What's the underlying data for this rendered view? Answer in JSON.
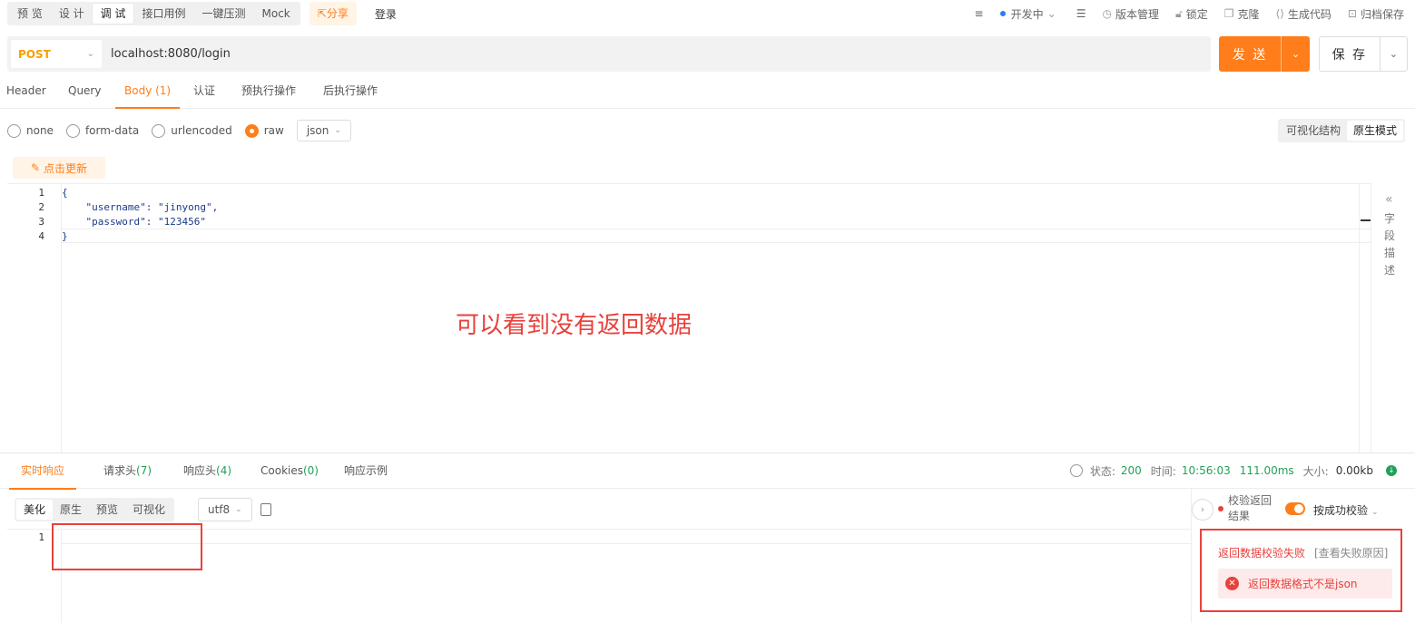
{
  "topbar": {
    "tabs": [
      {
        "label": "预 览"
      },
      {
        "label": "设 计"
      },
      {
        "label": "调 试",
        "active": true
      },
      {
        "label": "接口用例"
      },
      {
        "label": "一键压测"
      },
      {
        "label": "Mock"
      }
    ],
    "share_label": "分享",
    "login_label": "登录",
    "status_label": "开发中",
    "version_label": "版本管理",
    "lock_label": "锁定",
    "clone_label": "克隆",
    "codegen_label": "生成代码",
    "archive_label": "归档保存"
  },
  "request": {
    "method": "POST",
    "url": "localhost:8080/login",
    "send_label": "发 送",
    "save_label": "保 存"
  },
  "req_tabs": [
    {
      "label": "Header"
    },
    {
      "label": "Query"
    },
    {
      "label": "Body (1)",
      "active": true
    },
    {
      "label": "认证"
    },
    {
      "label": "预执行操作"
    },
    {
      "label": "后执行操作"
    }
  ],
  "body_types": {
    "none": "none",
    "form_data": "form-data",
    "urlencoded": "urlencoded",
    "raw": "raw",
    "selected": "raw",
    "format": "json"
  },
  "modes": {
    "visual": "可视化结构",
    "raw": "原生模式"
  },
  "refresh_label": "点击更新",
  "editor": {
    "lines": [
      "1",
      "2",
      "3",
      "4"
    ],
    "code": [
      "{",
      "    \"username\": \"jinyong\",",
      "    \"password\": \"123456\"",
      "}"
    ]
  },
  "side_panel_label": "字段描述",
  "annotation": "可以看到没有返回数据",
  "response": {
    "tabs": {
      "live": "实时响应",
      "req_headers": "请求头",
      "req_headers_count": "(7)",
      "resp_headers": "响应头",
      "resp_headers_count": "(4)",
      "cookies": "Cookies",
      "cookies_count": "(0)",
      "example": "响应示例"
    },
    "status_label": "状态:",
    "status_value": "200",
    "time_label": "时间:",
    "time_value": "10:56:03",
    "duration_value": "111.00ms",
    "size_label": "大小:",
    "size_value": "0.00kb",
    "view_modes": [
      "美化",
      "原生",
      "预览",
      "可视化"
    ],
    "encoding": "utf8",
    "line_number": "1"
  },
  "validation": {
    "title": "校验返回结果",
    "mode": "按成功校验",
    "fail": "返回数据校验失败",
    "reason": "[查看失败原因]",
    "error": "返回数据格式不是json"
  },
  "colors": {
    "accent": "#ff7d1a",
    "success": "#22a05a",
    "error": "#e8413c"
  }
}
